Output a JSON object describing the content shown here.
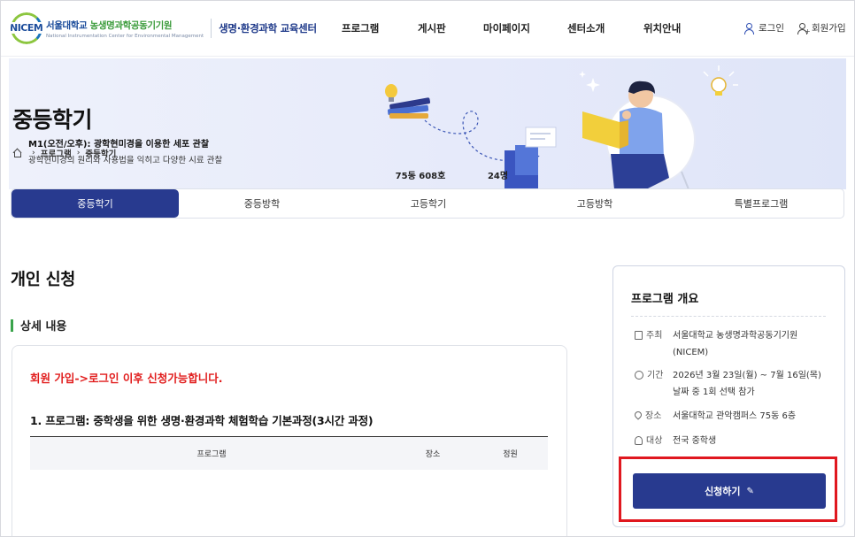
{
  "header": {
    "logo_abbr": "NICEM",
    "org_name_1": "서울대학교",
    "org_name_2": "농생명과학공동기기원",
    "org_name_en": "National Instrumentation Center for Environmental Management",
    "center_name": "생명·환경과학 교육센터",
    "nav": [
      "프로그램",
      "게시판",
      "마이페이지",
      "센터소개",
      "위치안내"
    ],
    "login_label": "로그인",
    "signup_label": "회원가입"
  },
  "hero": {
    "title": "중등학기",
    "breadcrumb": [
      "프로그램",
      "중등학기"
    ]
  },
  "tabs": [
    "중등학기",
    "중등방학",
    "고등학기",
    "고등방학",
    "특별프로그램"
  ],
  "active_tab": "중등학기",
  "main": {
    "section_title": "개인 신청",
    "sub_title": "상세 내용",
    "notice": "회원 가입->로그인 이후 신청가능합니다.",
    "program_title": "1. 프로그램: 중학생을 위한 생명·환경과학 체험학습 기본과정(3시간 과정)",
    "table": {
      "headers": [
        "프로그램",
        "장소",
        "정원"
      ],
      "rows": [
        {
          "title": "M1(오전/오후): 광학현미경을 이용한 세포 관찰",
          "desc": "광학현미경의 원리와 사용법을 익히고 다양한 시료 관찰",
          "place": "75동 608호",
          "capacity": "24명"
        }
      ]
    }
  },
  "overview": {
    "title": "프로그램 개요",
    "items": [
      {
        "label": "주최",
        "value": "서울대학교 농생명과학공동기기원 (NICEM)"
      },
      {
        "label": "기간",
        "value": "2026년 3월 23일(월) ~ 7월 16일(목) 날짜 중 1회 선택 참가"
      },
      {
        "label": "장소",
        "value": "서울대학교 관악캠퍼스 75동 6층"
      },
      {
        "label": "대상",
        "value": "전국 중학생"
      }
    ],
    "apply_label": "신청하기"
  },
  "colors": {
    "primary": "#283a8f",
    "notice_red": "#e11d1d",
    "highlight_red": "#e0181f",
    "accent_green": "#3aa34b"
  }
}
